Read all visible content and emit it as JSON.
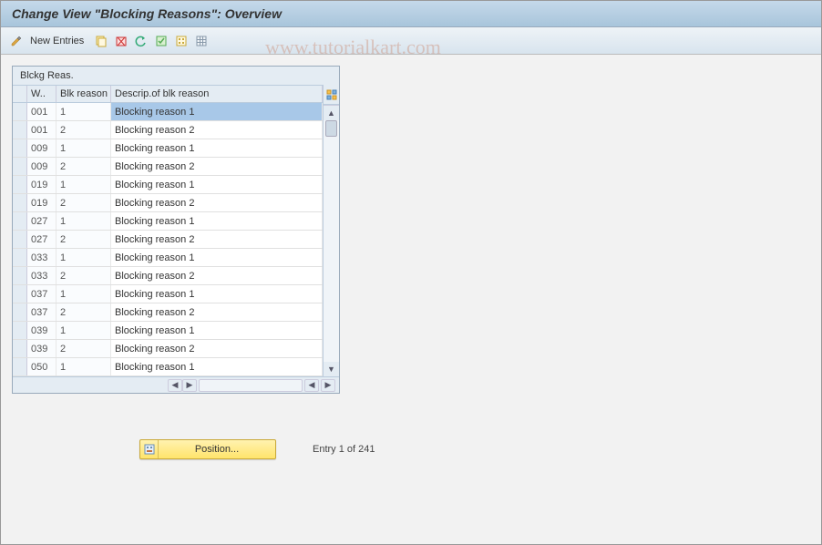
{
  "title": "Change View \"Blocking Reasons\": Overview",
  "watermark": "www.tutorialkart.com",
  "toolbar": {
    "new_entries": "New Entries"
  },
  "table": {
    "caption": "Blckg Reas.",
    "columns": {
      "w": "W..",
      "blk": "Blk reason",
      "desc": "Descrip.of blk reason"
    },
    "rows": [
      {
        "w": "001",
        "blk": "1",
        "desc": "Blocking reason 1",
        "selected": true
      },
      {
        "w": "001",
        "blk": "2",
        "desc": "Blocking reason 2"
      },
      {
        "w": "009",
        "blk": "1",
        "desc": "Blocking reason 1"
      },
      {
        "w": "009",
        "blk": "2",
        "desc": "Blocking reason 2"
      },
      {
        "w": "019",
        "blk": "1",
        "desc": "Blocking reason 1"
      },
      {
        "w": "019",
        "blk": "2",
        "desc": "Blocking reason 2"
      },
      {
        "w": "027",
        "blk": "1",
        "desc": "Blocking reason 1"
      },
      {
        "w": "027",
        "blk": "2",
        "desc": "Blocking reason 2"
      },
      {
        "w": "033",
        "blk": "1",
        "desc": "Blocking reason 1"
      },
      {
        "w": "033",
        "blk": "2",
        "desc": "Blocking reason 2"
      },
      {
        "w": "037",
        "blk": "1",
        "desc": "Blocking reason 1"
      },
      {
        "w": "037",
        "blk": "2",
        "desc": "Blocking reason 2"
      },
      {
        "w": "039",
        "blk": "1",
        "desc": "Blocking reason 1"
      },
      {
        "w": "039",
        "blk": "2",
        "desc": "Blocking reason 2"
      },
      {
        "w": "050",
        "blk": "1",
        "desc": "Blocking reason 1"
      }
    ]
  },
  "footer": {
    "position_label": "Position...",
    "entry_info": "Entry 1 of 241"
  },
  "colors": {
    "header_gradient_top": "#c5d9ea",
    "header_gradient_bottom": "#a8c5db",
    "selected_cell": "#a8c8e8",
    "button_yellow": "#ffe46b"
  },
  "chart_data": null
}
